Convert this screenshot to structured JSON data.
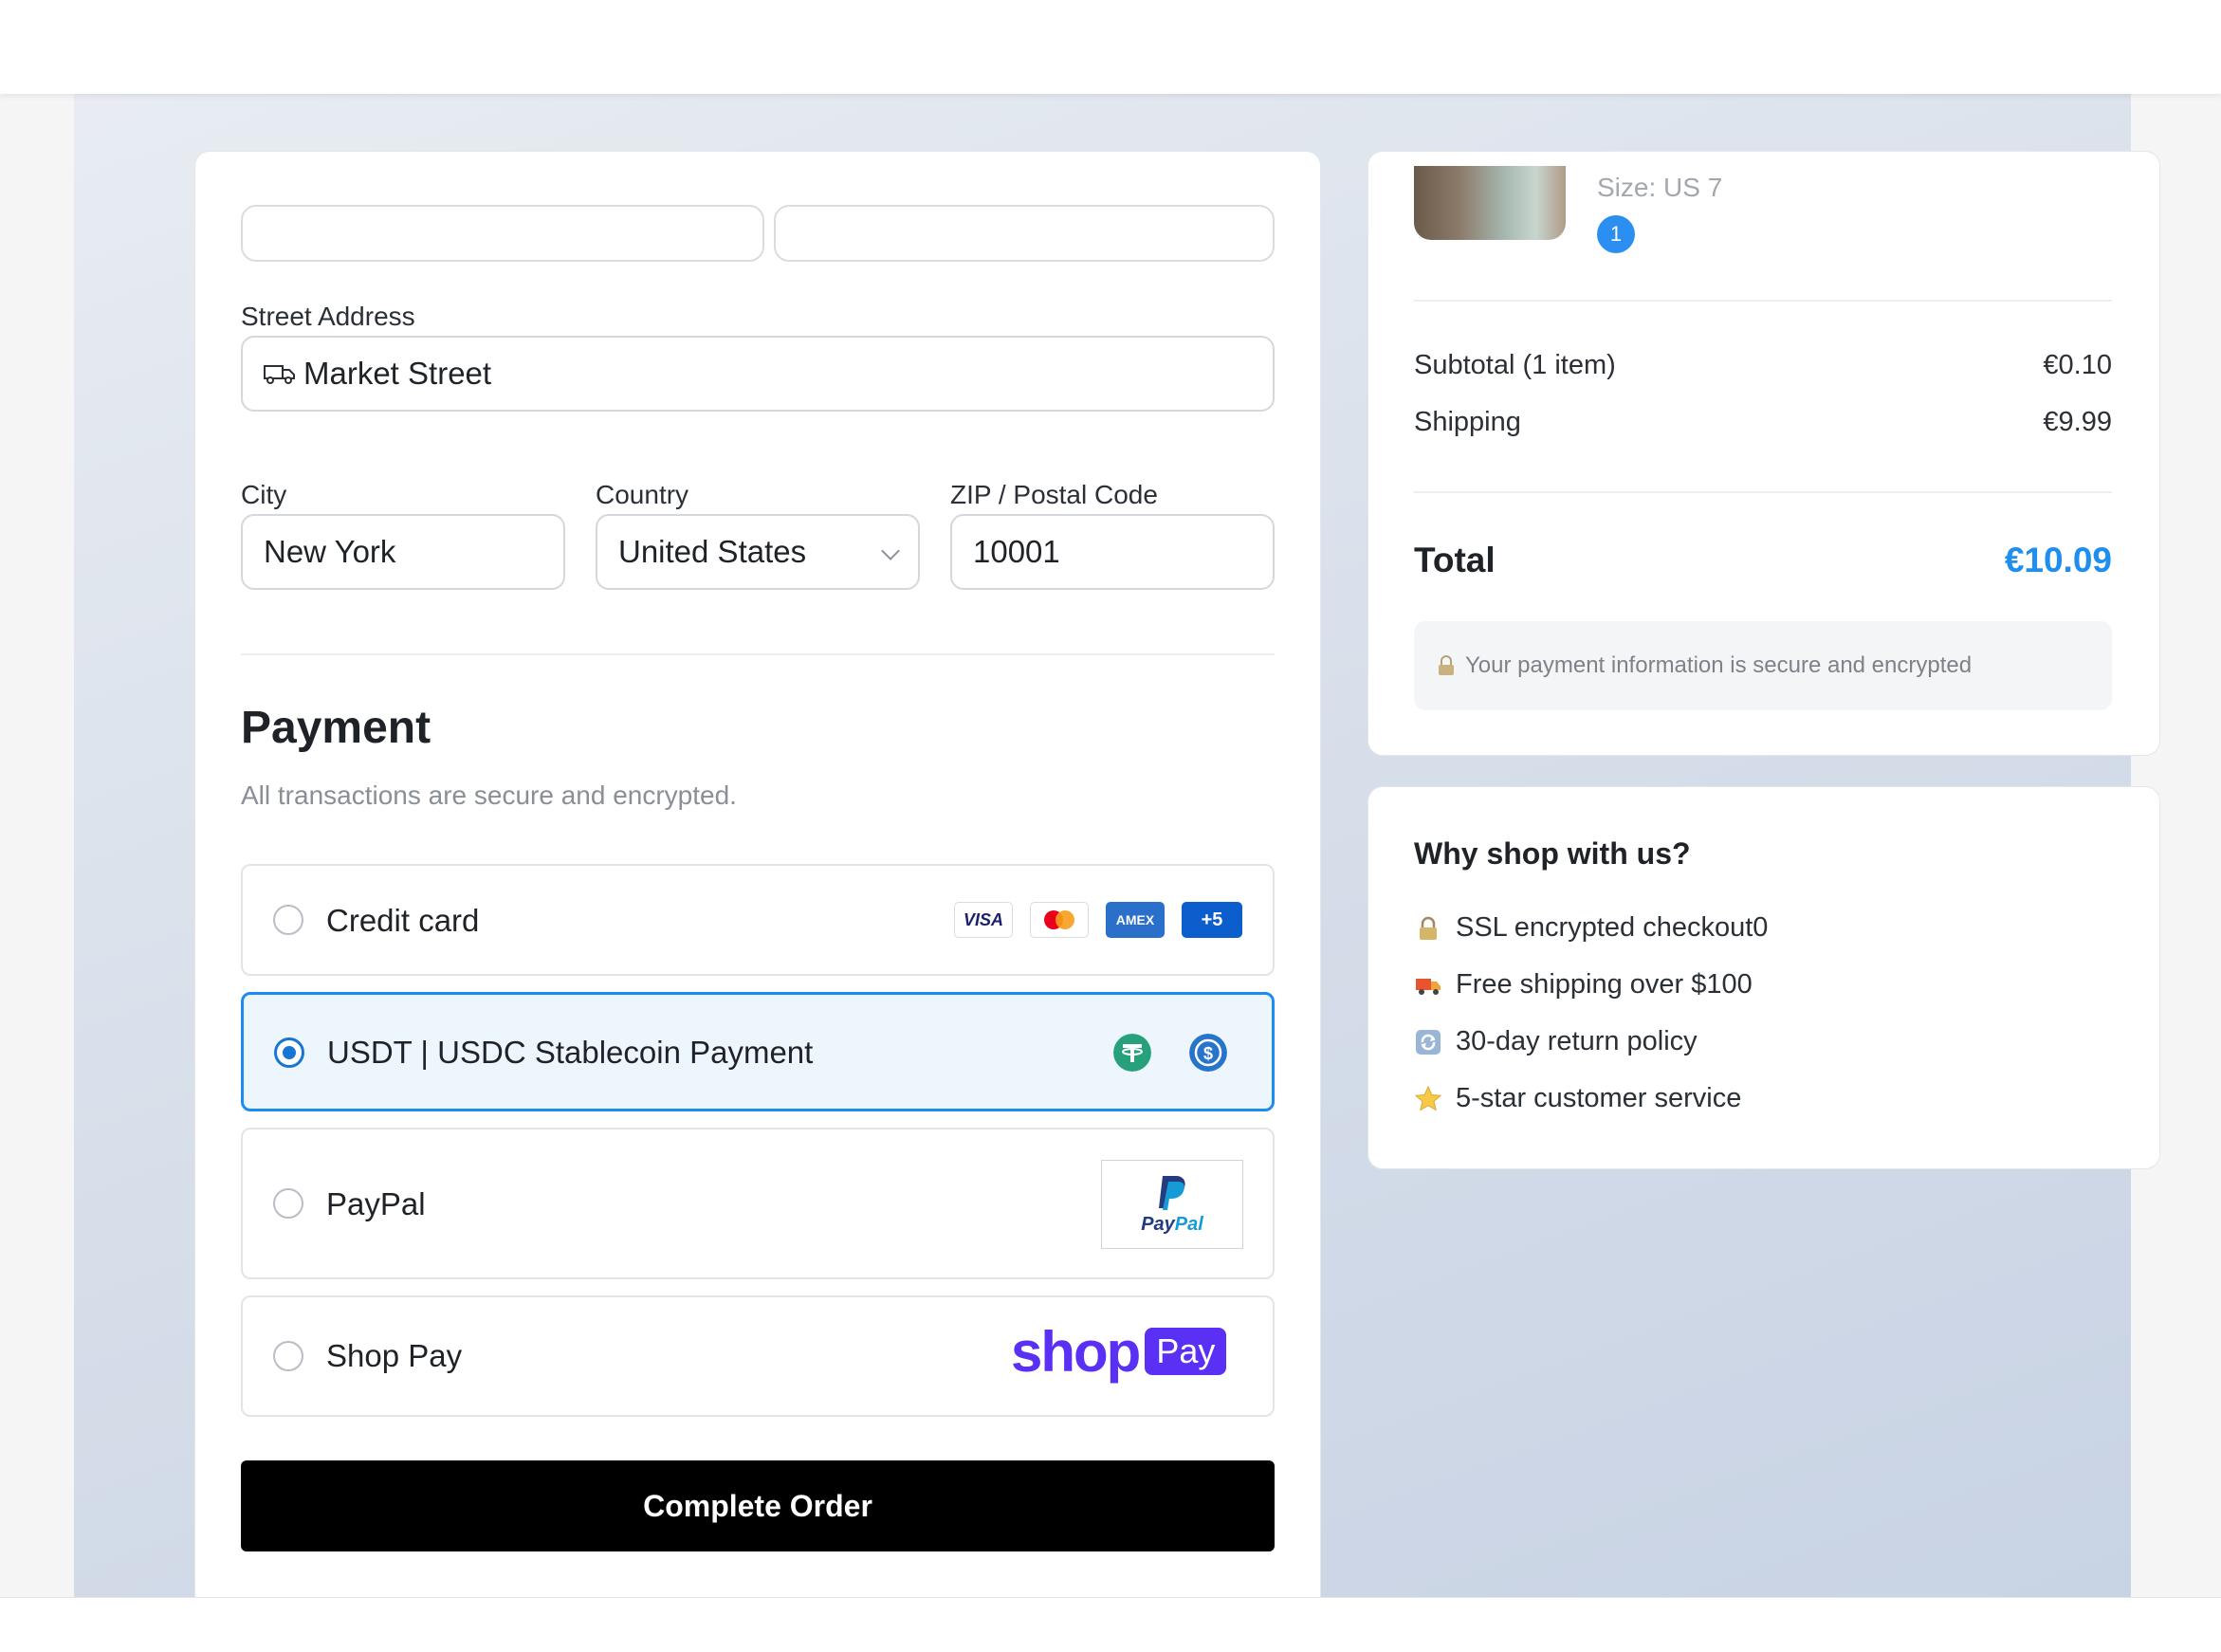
{
  "address": {
    "street_label": "Street Address",
    "street_value": "Market Street",
    "city_label": "City",
    "city_value": "New York",
    "country_label": "Country",
    "country_value": "United States",
    "zip_label": "ZIP / Postal Code",
    "zip_value": "10001"
  },
  "payment": {
    "title": "Payment",
    "subtitle": "All transactions are secure and encrypted.",
    "options": [
      {
        "label": "Credit card",
        "selected": false
      },
      {
        "label": "USDT | USDC Stablecoin Payment",
        "selected": true
      },
      {
        "label": "PayPal",
        "selected": false
      },
      {
        "label": "Shop Pay",
        "selected": false
      }
    ],
    "card_brands": {
      "visa": "VISA",
      "amex": "AMEX",
      "more": "+5"
    },
    "paypal_logo_text": {
      "pay": "Pay",
      "pal": "Pal"
    },
    "shoppay_logo_text": {
      "shop": "shop",
      "pay": "Pay"
    },
    "complete_button": "Complete Order",
    "colors": {
      "selected_border": "#1a8cf2",
      "selected_bg": "#eef6fd",
      "shop_purple": "#5a31f4"
    }
  },
  "summary": {
    "item_size": "Size: US 7",
    "item_qty": "1",
    "subtotal_label": "Subtotal (1 item)",
    "subtotal_value": "€0.10",
    "shipping_label": "Shipping",
    "shipping_value": "€9.99",
    "total_label": "Total",
    "total_value": "€10.09",
    "secure_note": "Your payment information is secure and encrypted",
    "colors": {
      "total_accent": "#1f8ef1",
      "qty_badge": "#2b8ff2"
    }
  },
  "why": {
    "title": "Why shop with us?",
    "items": [
      {
        "icon": "lock-icon",
        "text": "SSL encrypted checkout0"
      },
      {
        "icon": "truck-icon",
        "text": "Free shipping over $100"
      },
      {
        "icon": "return-icon",
        "text": "30-day return policy"
      },
      {
        "icon": "star-icon",
        "text": "5-star customer service"
      }
    ]
  }
}
